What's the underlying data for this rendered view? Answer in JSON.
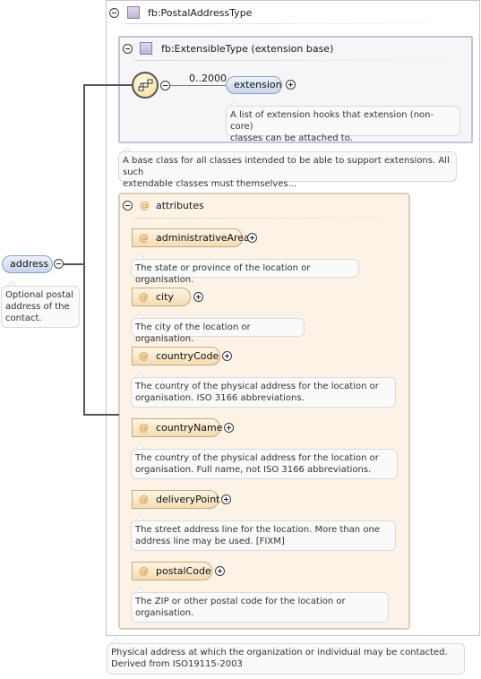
{
  "root": {
    "name": "address",
    "doc": [
      "Optional postal",
      "address of the",
      "contact."
    ]
  },
  "type": {
    "name": "fb:PostalAddressType",
    "doc": [
      "Physical address at which the organization or individual may be contacted.",
      "Derived from ISO19115-2003"
    ]
  },
  "extension_base": {
    "name": "fb:ExtensibleType (extension base)",
    "occurrence": "0..2000",
    "element": "extension",
    "element_doc": [
      "A list of extension hooks that extension (non-core)",
      "classes can be attached to."
    ],
    "doc": [
      "A base class for all classes intended to be able to support extensions. All such",
      "extendable classes must themselves..."
    ]
  },
  "attributes": {
    "title": "attributes",
    "symbol": "@",
    "items": [
      {
        "name": "administrativeArea",
        "doc": [
          "The state or province of the location or organisation."
        ]
      },
      {
        "name": "city",
        "doc": [
          "The city of the location or organisation."
        ]
      },
      {
        "name": "countryCode",
        "doc": [
          "The country of the physical address for the location or",
          "organisation. ISO 3166 abbreviations."
        ]
      },
      {
        "name": "countryName",
        "doc": [
          "The country of the physical address for the location or",
          "organisation. Full name, not ISO 3166 abbreviations."
        ]
      },
      {
        "name": "deliveryPoint",
        "doc": [
          "The street address line for the location. More than one",
          "address line may be used. [FIXM]"
        ]
      },
      {
        "name": "postalCode",
        "doc": [
          "The ZIP or other postal code for the location or",
          "organisation."
        ]
      }
    ]
  },
  "colors": {
    "element_fill": "#c7d6ec",
    "attribute_fill": "#f4dcb4",
    "attribute_symbol": "#d18a1d",
    "extension_border": "#c9c1d6",
    "attribute_group_bg": "#fcf3e6"
  }
}
